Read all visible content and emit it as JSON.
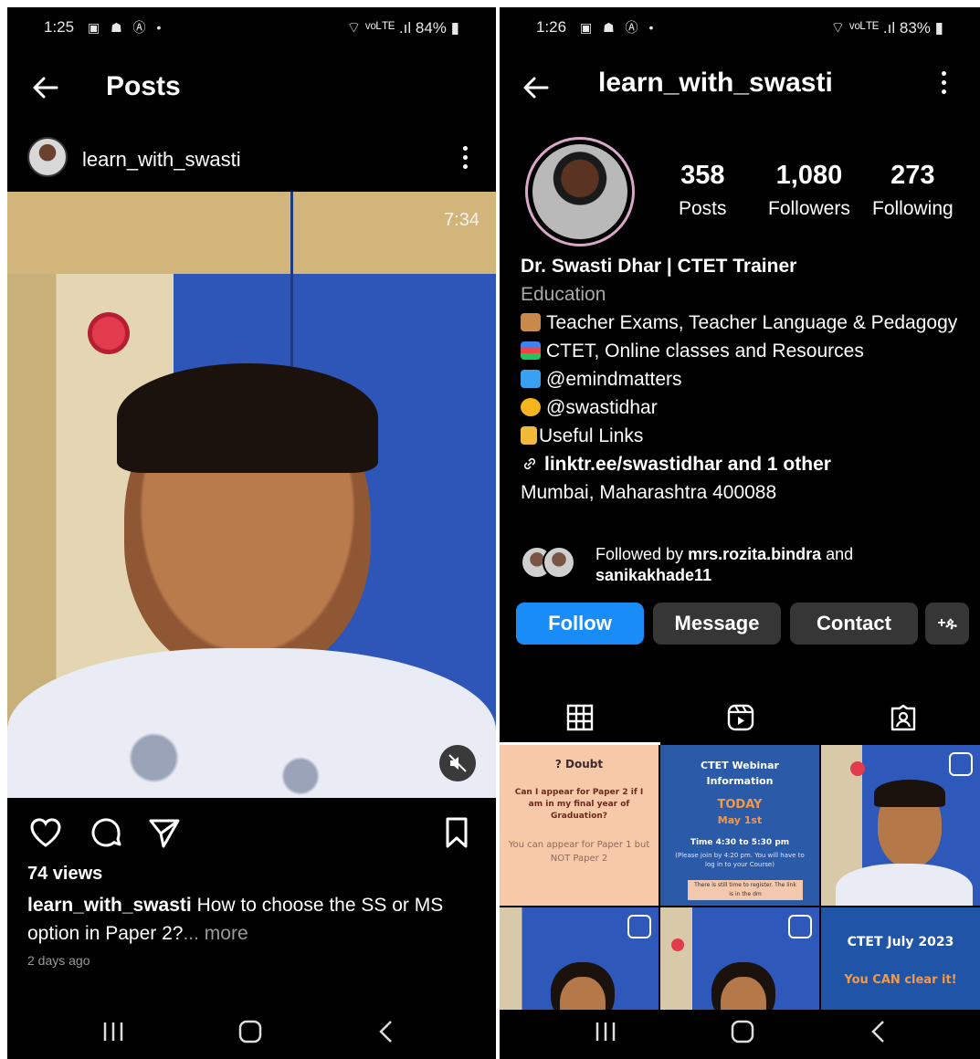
{
  "left": {
    "status": {
      "time": "1:25",
      "icons": "▣ ☗ Ⓐ •",
      "right": "⌔ ᵛᵒᴸᵀᴱ .ıl 84% ▮"
    },
    "header": {
      "title": "Posts"
    },
    "author": {
      "username": "learn_with_swasti"
    },
    "video": {
      "duration": "7:34"
    },
    "post": {
      "views": "74 views",
      "caption_user": "learn_with_swasti",
      "caption_text": " How to choose the SS or MS option in Paper 2?",
      "more": "... more",
      "time_ago": "2 days ago"
    }
  },
  "right": {
    "status": {
      "time": "1:26",
      "icons": "▣ ☗ Ⓐ •",
      "right": "⌔ ᵛᵒᴸᵀᴱ .ıl 83% ▮"
    },
    "header": {
      "title": "learn_with_swasti"
    },
    "stats": {
      "posts": {
        "value": "358",
        "label": "Posts"
      },
      "followers": {
        "value": "1,080",
        "label": "Followers"
      },
      "following": {
        "value": "273",
        "label": "Following"
      }
    },
    "bio": {
      "name": "Dr. Swasti Dhar  | CTET Trainer",
      "category": "Education",
      "line1": "Teacher Exams, Teacher Language & Pedagogy",
      "line2": "CTET, Online classes and Resources",
      "line3": "@emindmatters",
      "line4": "@swastidhar",
      "line5": "Useful Links",
      "link": "linktr.ee/swastidhar and 1 other",
      "location": "Mumbai, Maharashtra 400088"
    },
    "followed_by": {
      "prefix": "Followed by ",
      "user1": "mrs.rozita.bindra",
      "and": " and",
      "user2": "sanikakhade11"
    },
    "buttons": {
      "follow": "Follow",
      "message": "Message",
      "contact": "Contact",
      "add_person": "+ዹ"
    },
    "grid": {
      "post1": {
        "title": "Doubt",
        "question": "Can I appear for Paper 2 if I am in my final year of Graduation?",
        "answer": "You can appear for Paper 1 but NOT Paper 2"
      },
      "post2": {
        "title": "CTET Webinar Information",
        "today": "TODAY",
        "date": "May 1st",
        "time": "Time 4:30 to 5:30 pm",
        "note": "(Please join by 4:20 pm. You will have to log in to your Course)",
        "box": "There is still time to register. The link is in the dm"
      },
      "post6": {
        "title": "CTET July 2023",
        "sub": "You CAN clear it!"
      }
    },
    "colors": {
      "follow": "#1a8cf7",
      "button": "#363636",
      "post1_bg": "#f7c9a9",
      "post2_bg": "#2b5aa8",
      "post6_bg": "#1f54a7",
      "orange": "#f29a4b"
    }
  }
}
